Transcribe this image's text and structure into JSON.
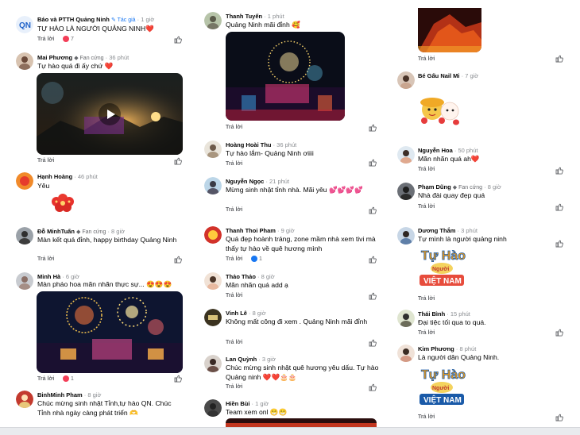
{
  "left": {
    "c1": {
      "name": "Báo và PTTH Quảng Ninh",
      "badge": "✎ Tác giả",
      "time": "· 1 giờ",
      "text": "TỰ HÀO LÀ NGƯỜI QUẢNG NINH❤️",
      "reply": "Trả lời",
      "react_count": "7"
    },
    "c2": {
      "name": "Mai Phương",
      "badge": "◆ Fan cứng",
      "time": "· 36 phút",
      "text": "Tự hào quá đi ấy chứ ❤️",
      "reply": "Trả lời"
    },
    "c3": {
      "name": "Hạnh Hoàng",
      "time": "· 46 phút",
      "text": "Yêu",
      "reply": "Trả lời"
    },
    "c4": {
      "name": "Đỗ MinhTuấn",
      "badge": "◆ Fan cứng",
      "time": "· 8 giờ",
      "text": "Màn kết quá đỉnh, happy birthday Quảng Ninh",
      "reply": "Trả lời"
    },
    "c5": {
      "name": "Minh Hà",
      "time": "· 6 giờ",
      "text": "Màn pháo hoa mãn nhãn thực sự... 😍😍😍",
      "reply": "Trả lời",
      "react_count": "1"
    },
    "c6": {
      "name": "BinhMinh Pham",
      "time": "· 8 giờ",
      "text": "Chúc mừng sinh nhật Tỉnh,tự hào QN. Chúc Tỉnh nhà ngày càng phát triển 🫶"
    }
  },
  "middle": {
    "c1": {
      "name": "Thanh Tuyến",
      "time": "· 1 phút",
      "text": "Quảng Ninh mãi đỉnh 🥰",
      "reply": "Trả lời"
    },
    "c2": {
      "name": "Hoàng Hoài Thu",
      "time": "· 36 phút",
      "text": "Tự hào lắm- Quảng Ninh ơiiii",
      "reply": "Trả lời"
    },
    "c3": {
      "name": "Nguyễn Ngọc",
      "time": "· 21 phút",
      "text": "Mừng sinh nhật tỉnh nhà. Mãi yêu 💕💕💕💕",
      "reply": "Trả lời"
    },
    "c4": {
      "name": "Thanh Thoi Pham",
      "time": "· 9 giờ",
      "text": "Quá đẹp hoành tráng, zone mầm nhà xem tivi mà thấy tự hào về quê hương mình",
      "reply": "Trả lời",
      "react_count": "1"
    },
    "c5": {
      "name": "Thảo Thảo",
      "time": "· 8 giờ",
      "text": "Mãn nhãn quá add ạ",
      "reply": "Trả lời"
    },
    "c6": {
      "name": "Vinh Lê",
      "time": "· 8 giờ",
      "text": "Không mất công đi xem . Quảng Ninh mãi đỉnh",
      "reply": "Trả lời"
    },
    "c7": {
      "name": "Lan Quỳnh",
      "time": "· 3 giờ",
      "text": "Chúc mừng sinh nhật quê hương yêu dấu. Tự hào Quảng ninh ❤️❤️🎂🎂",
      "reply": "Trả lời"
    },
    "c8": {
      "name": "Hiền Bùi",
      "time": "· 1 giờ",
      "text": "Team xem onl 😁😁"
    }
  },
  "right": {
    "c0": {
      "reply": "Trả lời"
    },
    "c1": {
      "name": "Bé Gấu Nail Mi",
      "time": "· 7 giờ",
      "reply": "Trả lời"
    },
    "c2": {
      "name": "Nguyễn Hoa",
      "time": "· 50 phút",
      "text": "Mãn nhãn quá ah❤️",
      "reply": "Trả lời"
    },
    "c3": {
      "name": "Phạm Dũng",
      "badge": "◆ Fan cứng",
      "time": "· 8 giờ",
      "text": "Nhà đài quay đẹp quá",
      "reply": "Trả lời"
    },
    "c4": {
      "name": "Dương Thắm",
      "time": "· 3 phút",
      "text": "Tự mình là người quảng ninh",
      "reply": "Trả lời",
      "sticker_top": "Tự Hào",
      "sticker_mid": "Người",
      "sticker_bottom": "VIỆT NAM"
    },
    "c5": {
      "name": "Thái Bình",
      "time": "· 15 phút",
      "text": "Đại tiệc tối qua to quá.",
      "reply": "Trả lời"
    },
    "c6": {
      "name": "Kim Phương",
      "time": "· 8 phút",
      "text": "Là người dân Quảng Ninh.",
      "reply": "Trả lời",
      "sticker_top": "Tự Hào",
      "sticker_mid": "Người",
      "sticker_bottom": "VIỆT NAM"
    }
  },
  "colors": {
    "reply": "#65676b",
    "like_blue": "#1877f2",
    "heart_red": "#f33e58",
    "text": "#050505",
    "meta": "#8a8d91"
  },
  "icons": {
    "like": "thumbs-up-icon",
    "play": "play-icon",
    "badge": "fan-badge-icon"
  }
}
